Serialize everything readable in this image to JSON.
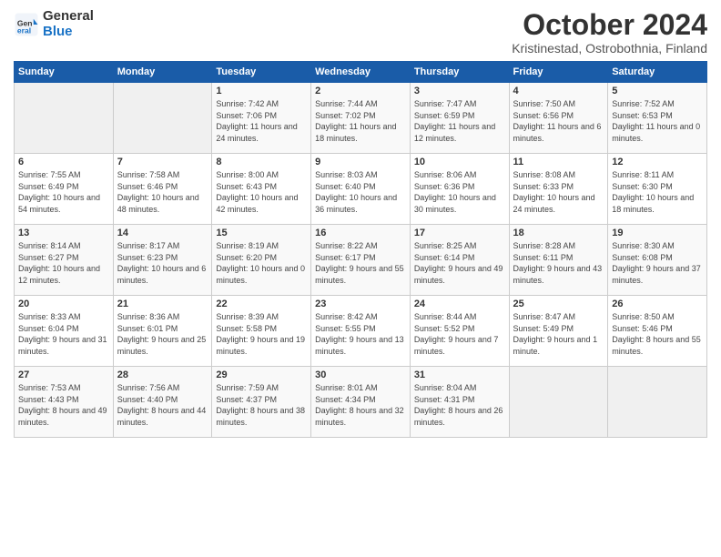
{
  "header": {
    "logo_line1": "General",
    "logo_line2": "Blue",
    "month": "October 2024",
    "location": "Kristinestad, Ostrobothnia, Finland"
  },
  "days_of_week": [
    "Sunday",
    "Monday",
    "Tuesday",
    "Wednesday",
    "Thursday",
    "Friday",
    "Saturday"
  ],
  "weeks": [
    [
      {
        "num": "",
        "sunrise": "",
        "sunset": "",
        "daylight": ""
      },
      {
        "num": "",
        "sunrise": "",
        "sunset": "",
        "daylight": ""
      },
      {
        "num": "1",
        "sunrise": "Sunrise: 7:42 AM",
        "sunset": "Sunset: 7:06 PM",
        "daylight": "Daylight: 11 hours and 24 minutes."
      },
      {
        "num": "2",
        "sunrise": "Sunrise: 7:44 AM",
        "sunset": "Sunset: 7:02 PM",
        "daylight": "Daylight: 11 hours and 18 minutes."
      },
      {
        "num": "3",
        "sunrise": "Sunrise: 7:47 AM",
        "sunset": "Sunset: 6:59 PM",
        "daylight": "Daylight: 11 hours and 12 minutes."
      },
      {
        "num": "4",
        "sunrise": "Sunrise: 7:50 AM",
        "sunset": "Sunset: 6:56 PM",
        "daylight": "Daylight: 11 hours and 6 minutes."
      },
      {
        "num": "5",
        "sunrise": "Sunrise: 7:52 AM",
        "sunset": "Sunset: 6:53 PM",
        "daylight": "Daylight: 11 hours and 0 minutes."
      }
    ],
    [
      {
        "num": "6",
        "sunrise": "Sunrise: 7:55 AM",
        "sunset": "Sunset: 6:49 PM",
        "daylight": "Daylight: 10 hours and 54 minutes."
      },
      {
        "num": "7",
        "sunrise": "Sunrise: 7:58 AM",
        "sunset": "Sunset: 6:46 PM",
        "daylight": "Daylight: 10 hours and 48 minutes."
      },
      {
        "num": "8",
        "sunrise": "Sunrise: 8:00 AM",
        "sunset": "Sunset: 6:43 PM",
        "daylight": "Daylight: 10 hours and 42 minutes."
      },
      {
        "num": "9",
        "sunrise": "Sunrise: 8:03 AM",
        "sunset": "Sunset: 6:40 PM",
        "daylight": "Daylight: 10 hours and 36 minutes."
      },
      {
        "num": "10",
        "sunrise": "Sunrise: 8:06 AM",
        "sunset": "Sunset: 6:36 PM",
        "daylight": "Daylight: 10 hours and 30 minutes."
      },
      {
        "num": "11",
        "sunrise": "Sunrise: 8:08 AM",
        "sunset": "Sunset: 6:33 PM",
        "daylight": "Daylight: 10 hours and 24 minutes."
      },
      {
        "num": "12",
        "sunrise": "Sunrise: 8:11 AM",
        "sunset": "Sunset: 6:30 PM",
        "daylight": "Daylight: 10 hours and 18 minutes."
      }
    ],
    [
      {
        "num": "13",
        "sunrise": "Sunrise: 8:14 AM",
        "sunset": "Sunset: 6:27 PM",
        "daylight": "Daylight: 10 hours and 12 minutes."
      },
      {
        "num": "14",
        "sunrise": "Sunrise: 8:17 AM",
        "sunset": "Sunset: 6:23 PM",
        "daylight": "Daylight: 10 hours and 6 minutes."
      },
      {
        "num": "15",
        "sunrise": "Sunrise: 8:19 AM",
        "sunset": "Sunset: 6:20 PM",
        "daylight": "Daylight: 10 hours and 0 minutes."
      },
      {
        "num": "16",
        "sunrise": "Sunrise: 8:22 AM",
        "sunset": "Sunset: 6:17 PM",
        "daylight": "Daylight: 9 hours and 55 minutes."
      },
      {
        "num": "17",
        "sunrise": "Sunrise: 8:25 AM",
        "sunset": "Sunset: 6:14 PM",
        "daylight": "Daylight: 9 hours and 49 minutes."
      },
      {
        "num": "18",
        "sunrise": "Sunrise: 8:28 AM",
        "sunset": "Sunset: 6:11 PM",
        "daylight": "Daylight: 9 hours and 43 minutes."
      },
      {
        "num": "19",
        "sunrise": "Sunrise: 8:30 AM",
        "sunset": "Sunset: 6:08 PM",
        "daylight": "Daylight: 9 hours and 37 minutes."
      }
    ],
    [
      {
        "num": "20",
        "sunrise": "Sunrise: 8:33 AM",
        "sunset": "Sunset: 6:04 PM",
        "daylight": "Daylight: 9 hours and 31 minutes."
      },
      {
        "num": "21",
        "sunrise": "Sunrise: 8:36 AM",
        "sunset": "Sunset: 6:01 PM",
        "daylight": "Daylight: 9 hours and 25 minutes."
      },
      {
        "num": "22",
        "sunrise": "Sunrise: 8:39 AM",
        "sunset": "Sunset: 5:58 PM",
        "daylight": "Daylight: 9 hours and 19 minutes."
      },
      {
        "num": "23",
        "sunrise": "Sunrise: 8:42 AM",
        "sunset": "Sunset: 5:55 PM",
        "daylight": "Daylight: 9 hours and 13 minutes."
      },
      {
        "num": "24",
        "sunrise": "Sunrise: 8:44 AM",
        "sunset": "Sunset: 5:52 PM",
        "daylight": "Daylight: 9 hours and 7 minutes."
      },
      {
        "num": "25",
        "sunrise": "Sunrise: 8:47 AM",
        "sunset": "Sunset: 5:49 PM",
        "daylight": "Daylight: 9 hours and 1 minute."
      },
      {
        "num": "26",
        "sunrise": "Sunrise: 8:50 AM",
        "sunset": "Sunset: 5:46 PM",
        "daylight": "Daylight: 8 hours and 55 minutes."
      }
    ],
    [
      {
        "num": "27",
        "sunrise": "Sunrise: 7:53 AM",
        "sunset": "Sunset: 4:43 PM",
        "daylight": "Daylight: 8 hours and 49 minutes."
      },
      {
        "num": "28",
        "sunrise": "Sunrise: 7:56 AM",
        "sunset": "Sunset: 4:40 PM",
        "daylight": "Daylight: 8 hours and 44 minutes."
      },
      {
        "num": "29",
        "sunrise": "Sunrise: 7:59 AM",
        "sunset": "Sunset: 4:37 PM",
        "daylight": "Daylight: 8 hours and 38 minutes."
      },
      {
        "num": "30",
        "sunrise": "Sunrise: 8:01 AM",
        "sunset": "Sunset: 4:34 PM",
        "daylight": "Daylight: 8 hours and 32 minutes."
      },
      {
        "num": "31",
        "sunrise": "Sunrise: 8:04 AM",
        "sunset": "Sunset: 4:31 PM",
        "daylight": "Daylight: 8 hours and 26 minutes."
      },
      {
        "num": "",
        "sunrise": "",
        "sunset": "",
        "daylight": ""
      },
      {
        "num": "",
        "sunrise": "",
        "sunset": "",
        "daylight": ""
      }
    ]
  ]
}
